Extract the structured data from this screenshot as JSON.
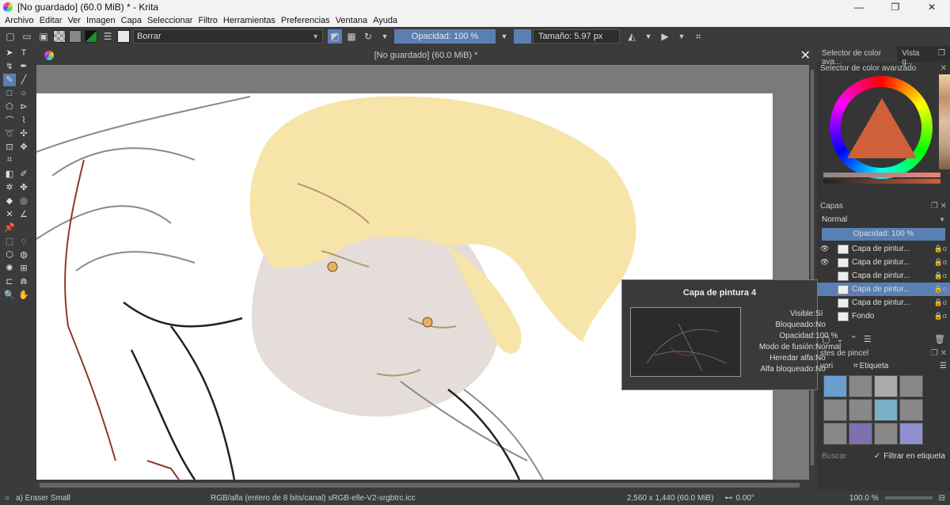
{
  "window": {
    "title": "[No guardado]  (60.0 MiB) * - Krita",
    "min": "—",
    "max": "❐",
    "close": "✕"
  },
  "menu": [
    "Archivo",
    "Editar",
    "Ver",
    "Imagen",
    "Capa",
    "Seleccionar",
    "Filtro",
    "Herramientas",
    "Preferencias",
    "Ventana",
    "Ayuda"
  ],
  "toolbar": {
    "preset_name": "Borrar",
    "opacity_label": "Opacidad: 100 %",
    "size_label": "Tamaño: 5.97 px"
  },
  "document": {
    "tab_title": "[No guardado]  (60.0 MiB) *"
  },
  "dock": {
    "tabs": [
      "Selector de color ava...",
      "Vista g..."
    ],
    "color_selector_title": "Selector de color avanzado",
    "layers_title": "Capas",
    "blend_mode": "Normal",
    "layers_opacity": "Opacidad:  100 %",
    "layers": [
      {
        "name": "Capa de pintur...",
        "selected": false
      },
      {
        "name": "Capa de pintur...",
        "selected": false
      },
      {
        "name": "Capa de pintur...",
        "selected": false
      },
      {
        "name": "Capa de pintur...",
        "selected": true
      },
      {
        "name": "Capa de pintur...",
        "selected": false
      },
      {
        "name": "Fondo",
        "selected": false
      }
    ],
    "brushes_title": "stes de pincel",
    "fav_label": "vori",
    "tag_label": "Etiqueta",
    "search_placeholder": "Buscar",
    "filter_label": "Filtrar en etiqueta"
  },
  "tooltip": {
    "title": "Capa de pintura 4",
    "props": [
      {
        "k": "Visible:",
        "v": "Sí"
      },
      {
        "k": "Bloqueado:",
        "v": "No"
      },
      {
        "k": "Opacidad:",
        "v": "100 %"
      },
      {
        "k": "Modo de fusión:",
        "v": "Normal"
      },
      {
        "k": "Heredar alfa:",
        "v": "No"
      },
      {
        "k": "Alfa bloqueado:",
        "v": "No"
      }
    ]
  },
  "status": {
    "brush": "a) Eraser Small",
    "color_space": "RGB/alfa (entero de 8 bits/canal)  sRGB-elle-V2-srgbtrc.icc",
    "dimensions": "2,560 x 1,440 (60.0 MiB)",
    "rotation": "0.00°",
    "zoom": "100.0 %"
  },
  "colors": {
    "accent": "#5a7fb3",
    "panel": "#3b3b3b",
    "canvas_bg": "#7a7a7a"
  }
}
